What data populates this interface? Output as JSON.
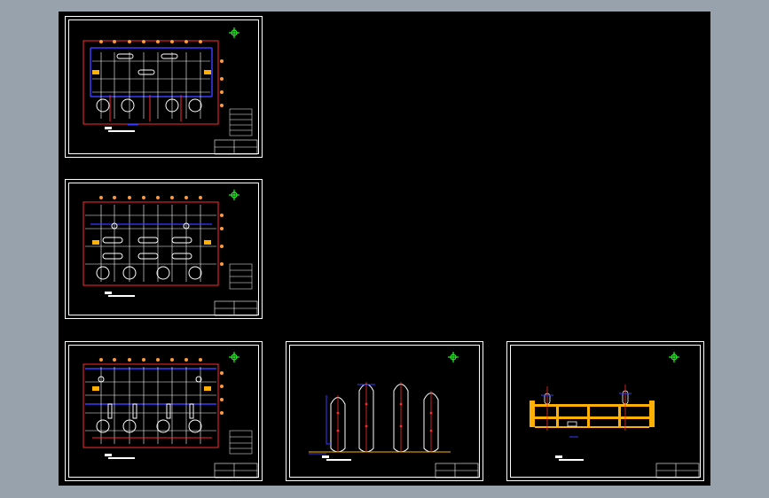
{
  "drawing_sheets": [
    {
      "id": "sheet-1",
      "view": "plan"
    },
    {
      "id": "sheet-2",
      "view": "plan"
    },
    {
      "id": "sheet-3",
      "view": "plan"
    },
    {
      "id": "sheet-4",
      "view": "elevation-tanks"
    },
    {
      "id": "sheet-5",
      "view": "elevation-section"
    }
  ],
  "colors": {
    "canvas_background": "#000000",
    "workspace_background": "#98a2ad",
    "frame": "#ffffff",
    "red": "#ff2a2a",
    "blue": "#3a3aff",
    "orange": "#ffb000",
    "green": "#22ee22",
    "white": "#ffffff"
  },
  "icons": [
    "north-arrow-icon"
  ]
}
